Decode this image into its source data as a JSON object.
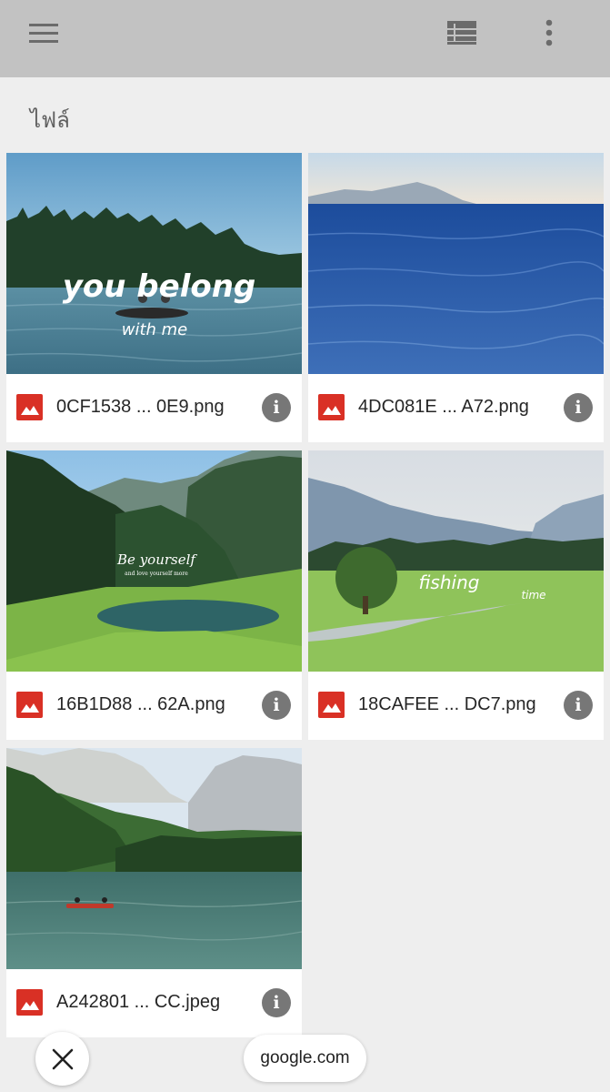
{
  "toolbar": {
    "menu_icon": "hamburger-menu-icon",
    "view_icon": "list-view-icon",
    "more_icon": "more-vert-icon"
  },
  "section": {
    "title": "ไฟล์"
  },
  "files": [
    {
      "name": "0CF1538 ... 0E9.png",
      "overlay": [
        "you belong",
        "with me"
      ]
    },
    {
      "name": "4DC081E ... A72.png"
    },
    {
      "name": "16B1D88 ... 62A.png",
      "overlay": [
        "Be yourself",
        "and love yourself more"
      ]
    },
    {
      "name": "18CAFEE ... DC7.png",
      "overlay": [
        "fishing",
        "time"
      ]
    },
    {
      "name": "A242801 ... CC.jpeg"
    }
  ],
  "bottom": {
    "close_icon": "close-icon",
    "url": "google.com"
  },
  "colors": {
    "toolbar_bg": "#c2c2c2",
    "page_bg": "#eeeeee",
    "image_file_icon": "#d93025",
    "info_icon_bg": "#777777"
  }
}
